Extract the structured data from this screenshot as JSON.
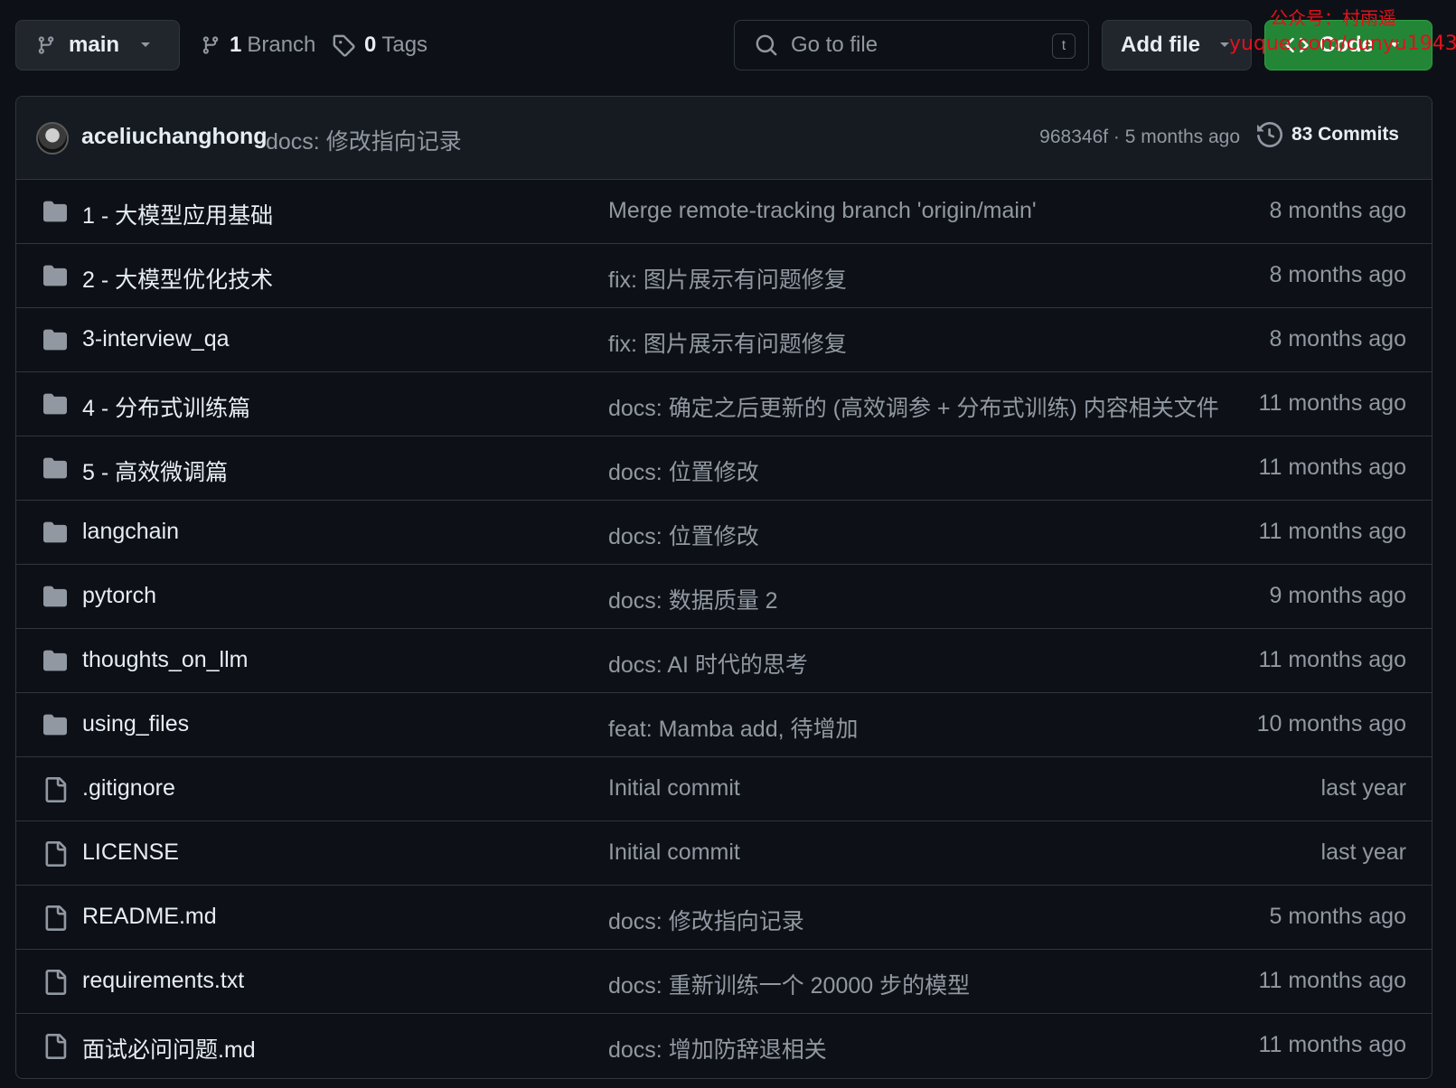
{
  "toolbar": {
    "branch_name": "main",
    "branch_count": "1",
    "branch_label": "Branch",
    "tag_count": "0",
    "tag_label": "Tags",
    "search_placeholder": "Go to file",
    "search_shortcut": "t",
    "add_file_label": "Add file",
    "code_label": "Code"
  },
  "watermark": {
    "line1": "公众号：村雨遥",
    "line2": "yuque.com/cunyu1943"
  },
  "latest_commit": {
    "author": "aceliuchanghong",
    "message": "docs: 修改指向记录",
    "hash_time": "968346f · 5 months ago",
    "commits_label": "83 Commits"
  },
  "files": [
    {
      "type": "folder",
      "name": "1 - 大模型应用基础",
      "message": "Merge remote-tracking branch 'origin/main'",
      "time": "8 months ago"
    },
    {
      "type": "folder",
      "name": "2 - 大模型优化技术",
      "message": "fix: 图片展示有问题修复",
      "time": "8 months ago"
    },
    {
      "type": "folder",
      "name": "3-interview_qa",
      "message": "fix: 图片展示有问题修复",
      "time": "8 months ago"
    },
    {
      "type": "folder",
      "name": "4 - 分布式训练篇",
      "message": "docs: 确定之后更新的 (高效调参 + 分布式训练) 内容相关文件",
      "time": "11 months ago"
    },
    {
      "type": "folder",
      "name": "5 - 高效微调篇",
      "message": "docs: 位置修改",
      "time": "11 months ago"
    },
    {
      "type": "folder",
      "name": "langchain",
      "message": "docs: 位置修改",
      "time": "11 months ago"
    },
    {
      "type": "folder",
      "name": "pytorch",
      "message": "docs: 数据质量 2",
      "time": "9 months ago"
    },
    {
      "type": "folder",
      "name": "thoughts_on_llm",
      "message": "docs: AI 时代的思考",
      "time": "11 months ago"
    },
    {
      "type": "folder",
      "name": "using_files",
      "message": "feat: Mamba add, 待增加",
      "time": "10 months ago"
    },
    {
      "type": "file",
      "name": ".gitignore",
      "message": "Initial commit",
      "time": "last year"
    },
    {
      "type": "file",
      "name": "LICENSE",
      "message": "Initial commit",
      "time": "last year"
    },
    {
      "type": "file",
      "name": "README.md",
      "message": "docs: 修改指向记录",
      "time": "5 months ago"
    },
    {
      "type": "file",
      "name": "requirements.txt",
      "message": "docs: 重新训练一个 20000 步的模型",
      "time": "11 months ago"
    },
    {
      "type": "file",
      "name": "面试必问问题.md",
      "message": "docs: 增加防辞退相关",
      "time": "11 months ago"
    }
  ],
  "colors": {
    "background": "#0d1117",
    "border": "#30363d",
    "muted_text": "#9198a1",
    "primary_text": "#e6edf3",
    "code_button": "#238636",
    "folder_icon": "#9198a1",
    "watermark": "#e0121c"
  },
  "icons": {
    "branch": "git-branch-icon",
    "tag": "tag-icon",
    "search": "search-icon",
    "code": "code-icon",
    "history": "history-icon",
    "folder": "folder-icon",
    "file": "file-icon"
  }
}
